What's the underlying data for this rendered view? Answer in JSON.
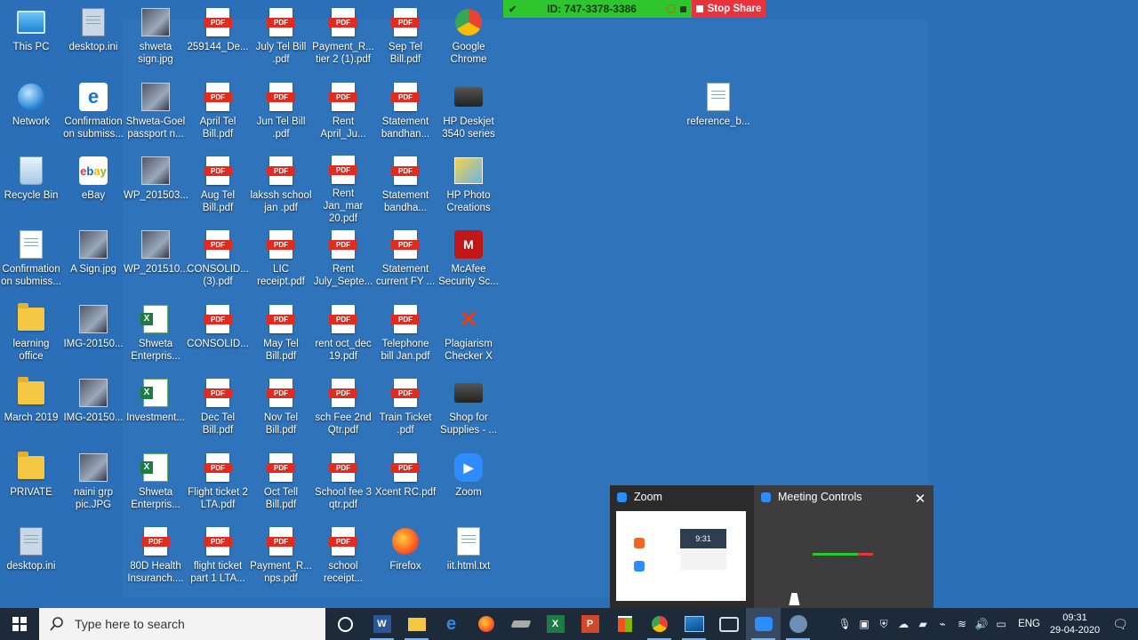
{
  "share_bar": {
    "meeting_id": "ID: 747-3378-3386",
    "stop_label": "Stop Share"
  },
  "desktop_icons": {
    "c0": [
      {
        "label": "This PC",
        "type": "pc"
      },
      {
        "label": "Network",
        "type": "network"
      },
      {
        "label": "Recycle Bin",
        "type": "recycle"
      },
      {
        "label": "Confirmation\non submiss...",
        "type": "doc"
      },
      {
        "label": "learning\noffice",
        "type": "folder"
      },
      {
        "label": "March 2019",
        "type": "folder"
      },
      {
        "label": "PRIVATE",
        "type": "folder"
      },
      {
        "label": "desktop.ini",
        "type": "gear"
      }
    ],
    "c1": [
      {
        "label": "desktop.ini",
        "type": "gear"
      },
      {
        "label": "Confirmation\non submiss...",
        "type": "edge"
      },
      {
        "label": "eBay",
        "type": "ebay"
      },
      {
        "label": "A Sign.jpg",
        "type": "photo"
      },
      {
        "label": "IMG-20150...",
        "type": "photo"
      },
      {
        "label": "IMG-20150...",
        "type": "photo"
      },
      {
        "label": "naini grp\npic.JPG",
        "type": "photo"
      }
    ],
    "c2": [
      {
        "label": "shweta\nsign.jpg",
        "type": "photo"
      },
      {
        "label": "Shweta-Goel\npassport n...",
        "type": "photo"
      },
      {
        "label": "WP_201503...",
        "type": "photo"
      },
      {
        "label": "WP_201510...",
        "type": "photo"
      },
      {
        "label": "Shweta\nEnterpris...",
        "type": "xls"
      },
      {
        "label": "Investment...",
        "type": "xls"
      },
      {
        "label": "Shweta\nEnterpris...",
        "type": "xls"
      },
      {
        "label": "80D Health\nInsuranch....",
        "type": "pdf"
      }
    ],
    "c3": [
      {
        "label": "259144_De...",
        "type": "pdf"
      },
      {
        "label": "April Tel\nBill.pdf",
        "type": "pdf"
      },
      {
        "label": "Aug Tel\nBill.pdf",
        "type": "pdf"
      },
      {
        "label": "CONSOLID...\n(3).pdf",
        "type": "pdf"
      },
      {
        "label": "CONSOLID...",
        "type": "pdf"
      },
      {
        "label": "Dec Tel\nBill.pdf",
        "type": "pdf"
      },
      {
        "label": "Flight ticket 2\nLTA.pdf",
        "type": "pdf"
      },
      {
        "label": "flight ticket\npart 1 LTA...",
        "type": "pdf"
      }
    ],
    "c4": [
      {
        "label": "July Tel Bill\n.pdf",
        "type": "pdf"
      },
      {
        "label": "Jun Tel Bill\n.pdf",
        "type": "pdf"
      },
      {
        "label": "lakssh school\njan .pdf",
        "type": "pdf"
      },
      {
        "label": "LIC\nreceipt.pdf",
        "type": "pdf"
      },
      {
        "label": "May Tel\nBill.pdf",
        "type": "pdf"
      },
      {
        "label": "Nov Tel\nBill.pdf",
        "type": "pdf"
      },
      {
        "label": "Oct Tell\nBill.pdf",
        "type": "pdf"
      },
      {
        "label": "Payment_R...\nnps.pdf",
        "type": "pdf"
      }
    ],
    "c5": [
      {
        "label": "Payment_R...\ntier 2 (1).pdf",
        "type": "pdf"
      },
      {
        "label": "Rent\nApril_Ju...",
        "type": "pdf"
      },
      {
        "label": "Rent Jan_mar\n20.pdf",
        "type": "pdf"
      },
      {
        "label": "Rent\nJuly_Septe...",
        "type": "pdf"
      },
      {
        "label": "rent oct_dec\n19.pdf",
        "type": "pdf"
      },
      {
        "label": "sch Fee 2nd\nQtr.pdf",
        "type": "pdf"
      },
      {
        "label": "School fee 3\nqtr.pdf",
        "type": "pdf"
      },
      {
        "label": "school\nreceipt...",
        "type": "pdf"
      }
    ],
    "c6": [
      {
        "label": "Sep Tel\nBill.pdf",
        "type": "pdf"
      },
      {
        "label": "Statement\nbandhan...",
        "type": "pdf"
      },
      {
        "label": "Statement\nbandha...",
        "type": "pdf"
      },
      {
        "label": "Statement\ncurrent FY ...",
        "type": "pdf"
      },
      {
        "label": "Telephone\nbill Jan.pdf",
        "type": "pdf"
      },
      {
        "label": "Train Ticket\n.pdf",
        "type": "pdf"
      },
      {
        "label": "Xcent RC.pdf",
        "type": "pdf"
      },
      {
        "label": "Firefox",
        "type": "firefox"
      }
    ],
    "c7": [
      {
        "label": "Google\nChrome",
        "type": "chrome"
      },
      {
        "label": "HP Deskjet\n3540 series",
        "type": "printer"
      },
      {
        "label": "HP Photo\nCreations",
        "type": "hpphoto"
      },
      {
        "label": "McAfee\nSecurity Sc...",
        "type": "mcafee"
      },
      {
        "label": "Plagiarism\nChecker X",
        "type": "plag"
      },
      {
        "label": "Shop for\nSupplies - ...",
        "type": "printer"
      },
      {
        "label": "Zoom",
        "type": "zoom"
      },
      {
        "label": "iit.html.txt",
        "type": "doc"
      }
    ],
    "other": [
      {
        "label": "reference_b...",
        "type": "doc"
      }
    ]
  },
  "previews": {
    "zoom_title": "Zoom",
    "controls_title": "Meeting Controls",
    "thumb_time": "9:31"
  },
  "taskbar": {
    "search_placeholder": "Type here to search",
    "language": "ENG",
    "time": "09:31",
    "date": "29-04-2020"
  },
  "colors": {
    "desktop": "#2a6fb7",
    "share_green": "#2ec52e",
    "stop_red": "#e8323c",
    "taskbar": "#1d2a3a"
  }
}
